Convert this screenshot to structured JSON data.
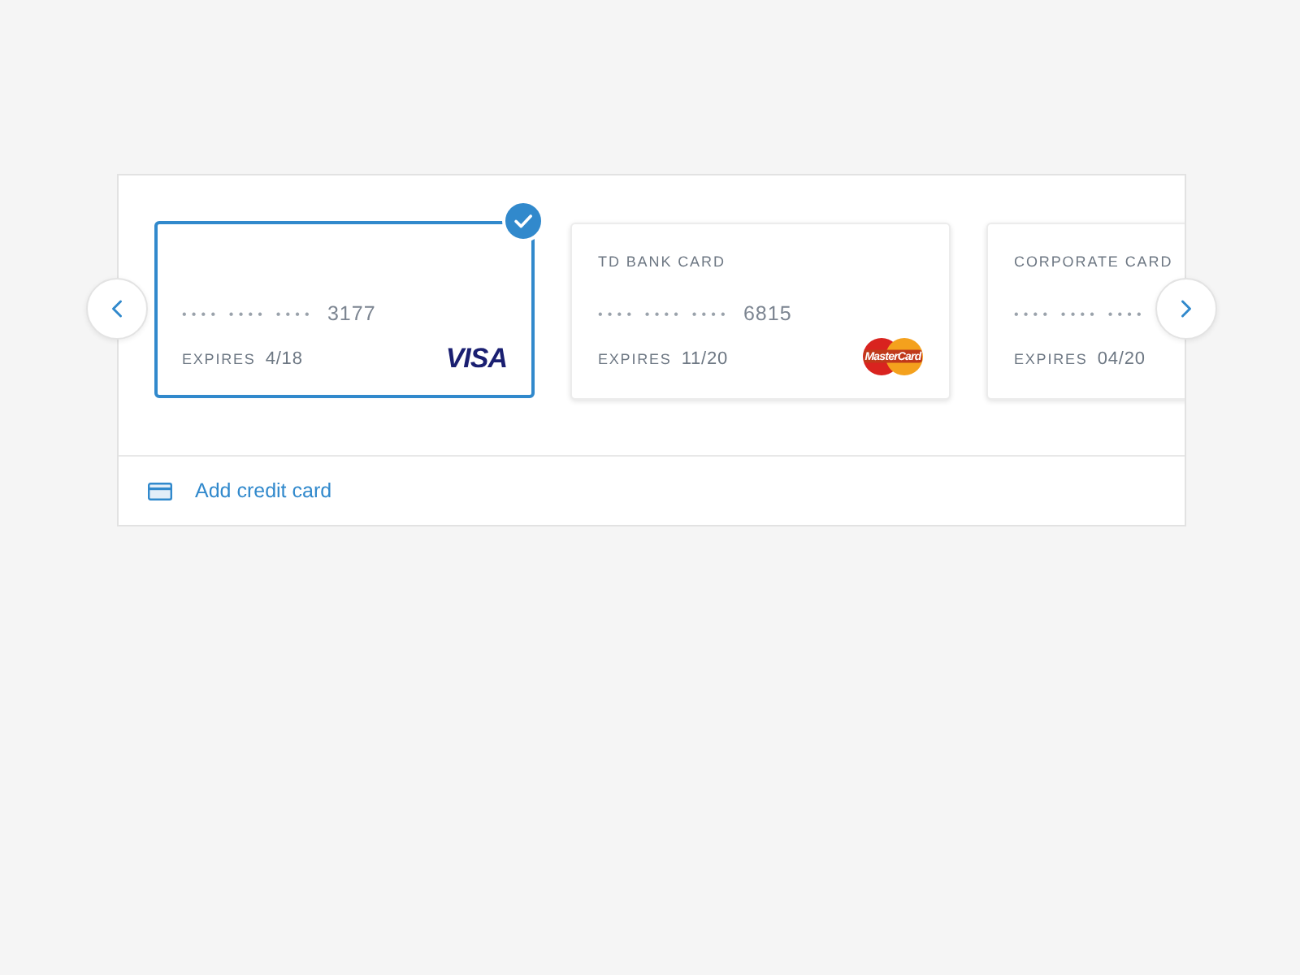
{
  "cards": [
    {
      "selected": true,
      "mask": "•••• •••• ••••",
      "last4": "3177",
      "expires_label": "EXPIRES",
      "expires": "4/18",
      "logo": {
        "kind": "visa",
        "text": "VISA"
      }
    },
    {
      "selected": false,
      "name": "TD BANK CARD",
      "mask": "•••• •••• ••••",
      "last4": "6815",
      "expires_label": "EXPIRES",
      "expires": "11/20",
      "logo": {
        "kind": "mastercard",
        "text": "MasterCard"
      }
    },
    {
      "selected": false,
      "name": "CORPORATE CARD",
      "mask": "•••• •••• ••••",
      "expires_label": "EXPIRES",
      "expires": "04/20"
    }
  ],
  "add_card": {
    "label": "Add credit card"
  }
}
